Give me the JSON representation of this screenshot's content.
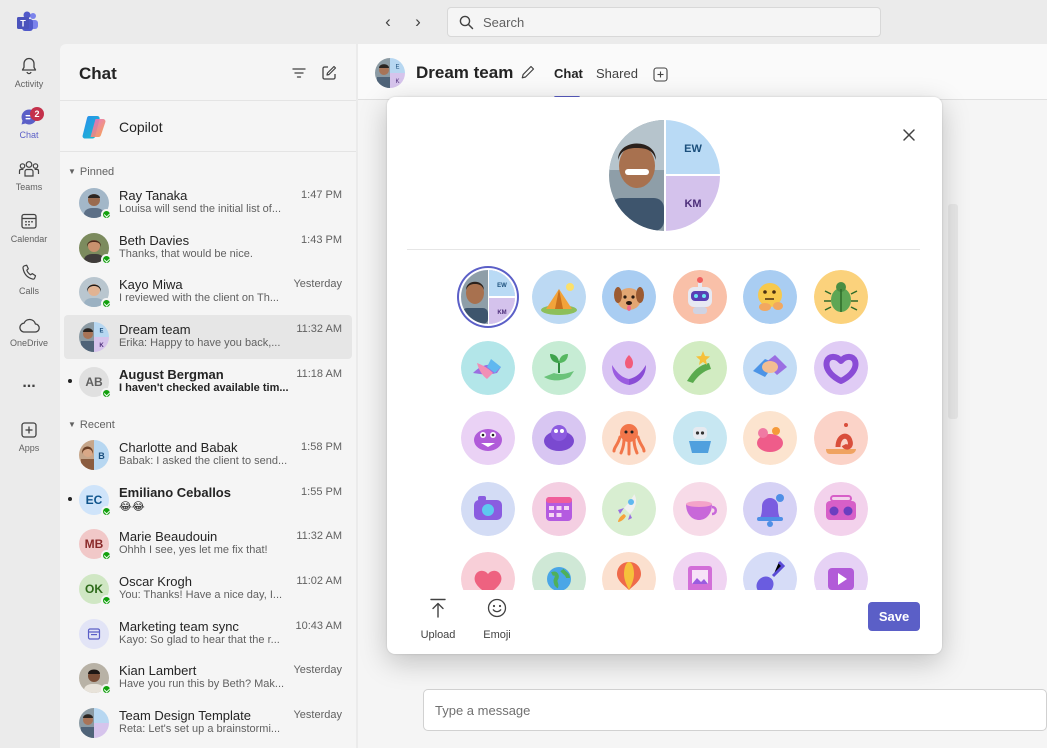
{
  "search": {
    "placeholder": "Search"
  },
  "rail": [
    {
      "label": "Activity",
      "icon": "bell-icon"
    },
    {
      "label": "Chat",
      "icon": "chat-icon",
      "badge": "2"
    },
    {
      "label": "Teams",
      "icon": "teams-icon"
    },
    {
      "label": "Calendar",
      "icon": "calendar-icon"
    },
    {
      "label": "Calls",
      "icon": "phone-icon"
    },
    {
      "label": "OneDrive",
      "icon": "cloud-icon"
    },
    {
      "label": "...",
      "icon": "more-icon"
    },
    {
      "label": "Apps",
      "icon": "add-apps-icon"
    }
  ],
  "chatlist": {
    "title": "Chat",
    "copilot": "Copilot",
    "pinned_label": "Pinned",
    "recent_label": "Recent",
    "pinned": [
      {
        "name": "Ray Tanaka",
        "message": "Louisa will send the initial list of...",
        "time": "1:47 PM"
      },
      {
        "name": "Beth Davies",
        "message": "Thanks, that would be nice.",
        "time": "1:43 PM"
      },
      {
        "name": "Kayo Miwa",
        "message": "I reviewed with the client on Th...",
        "time": "Yesterday"
      },
      {
        "name": "Dream team",
        "message": "Erika: Happy to have you back,...",
        "time": "11:32 AM"
      },
      {
        "name": "August Bergman",
        "initials": "AB",
        "message": "I haven't checked available tim...",
        "time": "11:18 AM"
      }
    ],
    "recent": [
      {
        "name": "Charlotte and Babak",
        "message": "Babak: I asked the client to send...",
        "time": "1:58 PM"
      },
      {
        "name": "Emiliano Ceballos",
        "initials": "EC",
        "message": "😂😂",
        "time": "1:55 PM"
      },
      {
        "name": "Marie Beaudouin",
        "initials": "MB",
        "message": "Ohhh I see, yes let me fix that!",
        "time": "11:32 AM"
      },
      {
        "name": "Oscar Krogh",
        "initials": "OK",
        "message": "You: Thanks! Have a nice day, I...",
        "time": "11:02 AM"
      },
      {
        "name": "Marketing team sync",
        "message": "Kayo: So glad to hear that the r...",
        "time": "10:43 AM"
      },
      {
        "name": "Kian Lambert",
        "message": "Have you run this by Beth? Mak...",
        "time": "Yesterday"
      },
      {
        "name": "Team Design Template",
        "message": "Reta: Let's set up a brainstormi...",
        "time": "Yesterday"
      }
    ]
  },
  "main": {
    "title": "Dream team",
    "tabs": [
      "Chat",
      "Shared"
    ],
    "composer_placeholder": "Type a message"
  },
  "dialog": {
    "initials": [
      "EW",
      "KM"
    ],
    "footer": {
      "upload": "Upload",
      "emoji": "Emoji",
      "save": "Save"
    },
    "options": [
      "current-group-photo",
      "camping-tent",
      "dog",
      "robot",
      "thinking-face",
      "bug",
      "helping-hands",
      "plant-in-hand",
      "hands-with-flame",
      "plant-sprout-star",
      "handshake",
      "heart-hands",
      "purple-monster",
      "purple-creature",
      "orange-octopus",
      "robot-in-cup",
      "coral-creature",
      "snail",
      "camera",
      "calendar-grid",
      "rocket",
      "teacup",
      "bell",
      "boombox",
      "heart",
      "globe",
      "hot-air-balloon",
      "picture-frame",
      "guitar",
      "play-button"
    ]
  }
}
